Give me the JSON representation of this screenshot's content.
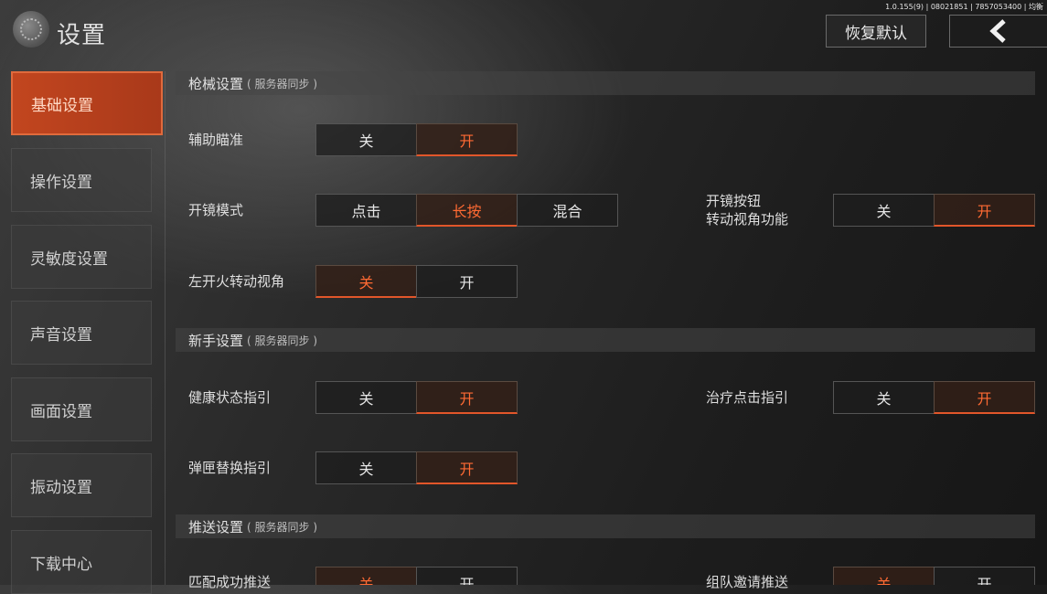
{
  "version": "1.0.155(9) | 08021851 | 7857053400 | 均衡",
  "header": {
    "title": "设置",
    "reset_label": "恢复默认",
    "back_icon": "chevron-left-icon"
  },
  "sidebar": {
    "items": [
      {
        "label": "基础设置",
        "active": true
      },
      {
        "label": "操作设置",
        "active": false
      },
      {
        "label": "灵敏度设置",
        "active": false
      },
      {
        "label": "声音设置",
        "active": false
      },
      {
        "label": "画面设置",
        "active": false
      },
      {
        "label": "振动设置",
        "active": false
      },
      {
        "label": "下载中心",
        "active": false
      }
    ]
  },
  "sections": [
    {
      "title": "枪械设置",
      "sub": "( 服务器同步 )"
    },
    {
      "title": "新手设置",
      "sub": "( 服务器同步 )"
    },
    {
      "title": "推送设置",
      "sub": "( 服务器同步 )"
    }
  ],
  "settings": {
    "aim_assist": {
      "label": "辅助瞄准",
      "options": [
        "关",
        "开"
      ],
      "selected": 1
    },
    "scope_mode": {
      "label": "开镜模式",
      "options": [
        "点击",
        "长按",
        "混合"
      ],
      "selected": 1
    },
    "scope_button": {
      "label_line1": "开镜按钮",
      "label_line2": "转动视角功能",
      "options": [
        "关",
        "开"
      ],
      "selected": 1
    },
    "left_fire": {
      "label": "左开火转动视角",
      "options": [
        "关",
        "开"
      ],
      "selected": 0
    },
    "health_guide": {
      "label": "健康状态指引",
      "options": [
        "关",
        "开"
      ],
      "selected": 1
    },
    "heal_guide": {
      "label": "治疗点击指引",
      "options": [
        "关",
        "开"
      ],
      "selected": 1
    },
    "mag_guide": {
      "label": "弹匣替换指引",
      "options": [
        "关",
        "开"
      ],
      "selected": 1
    },
    "match_push": {
      "label": "匹配成功推送",
      "options": [
        "关",
        "开"
      ],
      "selected": 0
    },
    "team_push": {
      "label": "组队邀请推送",
      "options": [
        "关",
        "开"
      ],
      "selected": 0
    }
  },
  "colors": {
    "accent": "#e2562a",
    "active_tab": "#b9411d"
  }
}
